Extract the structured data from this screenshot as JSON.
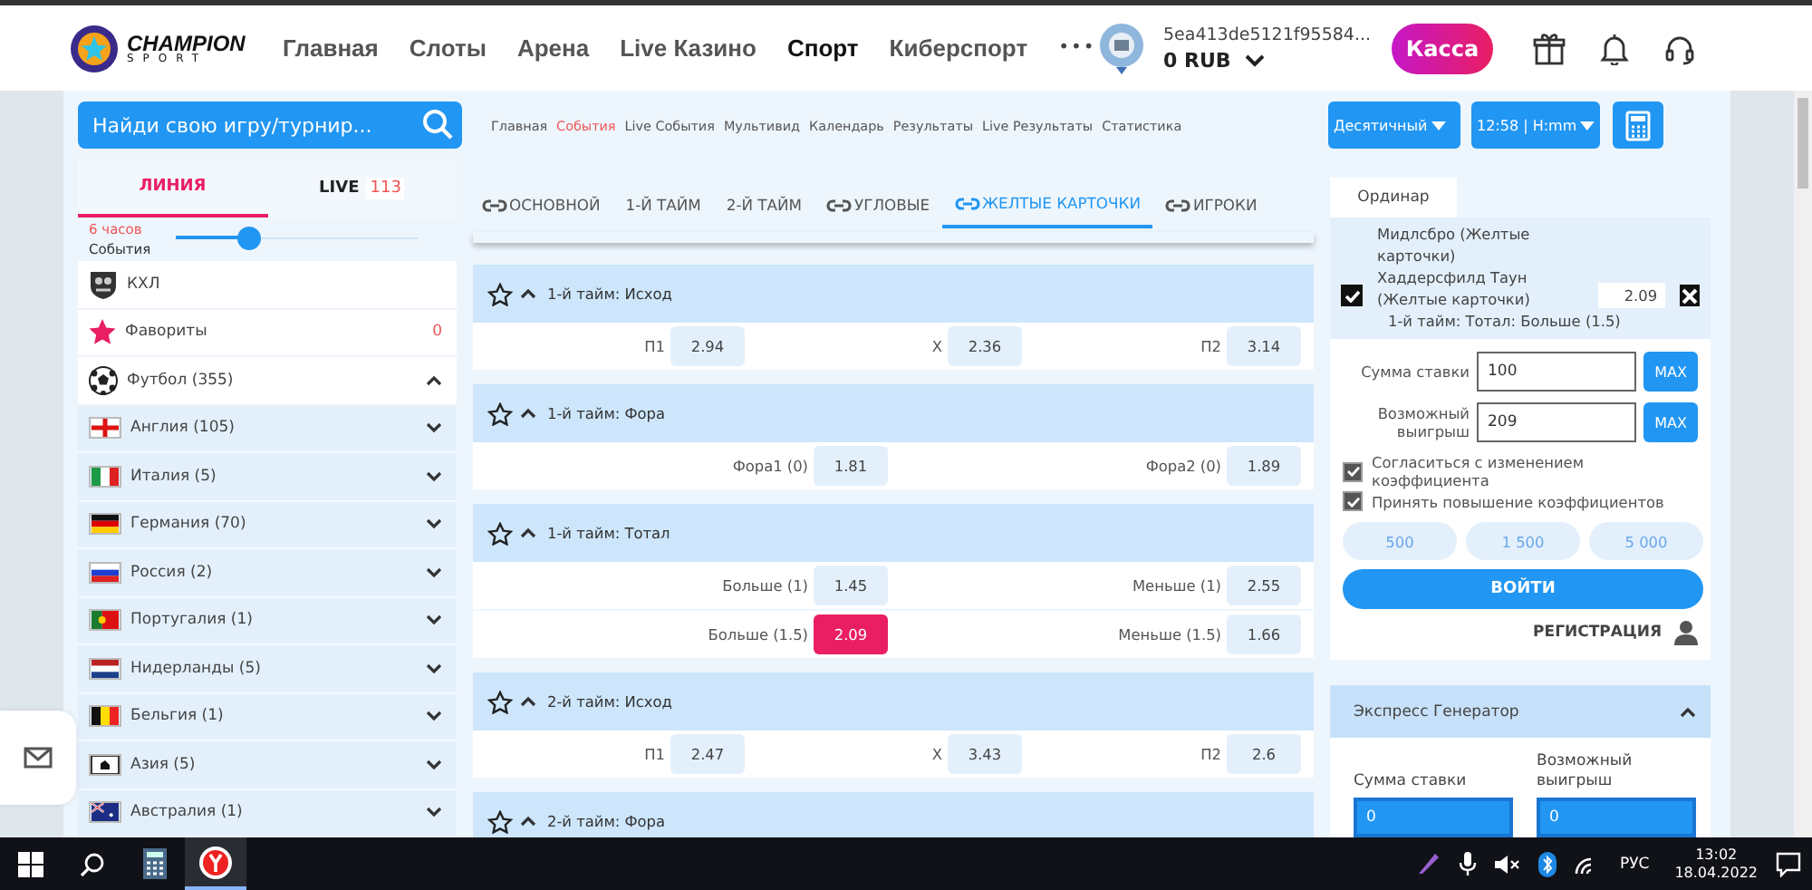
{
  "header": {
    "logo": {
      "title": "CHAMPION",
      "subtitle": "SPORT"
    },
    "nav": [
      {
        "label": "Главная",
        "selected": false
      },
      {
        "label": "Слоты",
        "selected": false
      },
      {
        "label": "Арена",
        "selected": false
      },
      {
        "label": "Live Казино",
        "selected": false
      },
      {
        "label": "Спорт",
        "selected": true
      },
      {
        "label": "Киберспорт",
        "selected": false
      }
    ],
    "more": "•••",
    "account": {
      "id": "5ea413de5121f95584...",
      "balance": "0 RUB"
    },
    "cashier": "Касса"
  },
  "toolbar": {
    "search": {
      "placeholder": "Найди свою игру/турнир..."
    },
    "links": [
      {
        "label": "Главная",
        "selected": false
      },
      {
        "label": "События",
        "selected": true
      },
      {
        "label": "Live События",
        "selected": false
      },
      {
        "label": "Мультивид",
        "selected": false
      },
      {
        "label": "Календарь",
        "selected": false
      },
      {
        "label": "Результаты",
        "selected": false
      },
      {
        "label": "Live Результаты",
        "selected": false
      },
      {
        "label": "Статистика",
        "selected": false
      }
    ],
    "odds_format": "Десятичный",
    "time_format": "12:58 | H:mm"
  },
  "sidebar": {
    "tabs": [
      {
        "label": "ЛИНИЯ",
        "selected": true
      },
      {
        "label": "LIVE",
        "count": "113",
        "selected": false
      }
    ],
    "filter": {
      "period": "6 часов",
      "label": "События",
      "level": 0.3
    },
    "items": [
      {
        "kind": "league",
        "label": "КХЛ"
      },
      {
        "kind": "favorites",
        "label": "Фавориты",
        "count": "0"
      },
      {
        "kind": "sport",
        "label": "Футбол (355)",
        "expanded": true,
        "children": [
          {
            "label": "Англия (105)",
            "expanded": false
          },
          {
            "label": "Италия (5)",
            "expanded": false
          },
          {
            "label": "Германия (70)",
            "expanded": false
          },
          {
            "label": "Россия (2)",
            "expanded": false
          },
          {
            "label": "Португалия (1)",
            "expanded": false
          },
          {
            "label": "Нидерланды (5)",
            "expanded": false
          },
          {
            "label": "Бельгия (1)",
            "expanded": false
          },
          {
            "label": "Азия (5)",
            "expanded": false
          },
          {
            "label": "Австралия (1)",
            "expanded": false
          }
        ]
      }
    ]
  },
  "market_tabs": [
    {
      "label": "ОСНОВНОЙ",
      "linked": true,
      "selected": false
    },
    {
      "label": "1-Й ТАЙМ",
      "linked": false,
      "selected": false
    },
    {
      "label": "2-Й ТАЙМ",
      "linked": false,
      "selected": false
    },
    {
      "label": "УГЛОВЫЕ",
      "linked": true,
      "selected": false
    },
    {
      "label": "ЖЕЛТЫЕ КАРТОЧКИ",
      "linked": true,
      "selected": true
    },
    {
      "label": "ИГРОКИ",
      "linked": true,
      "selected": false
    }
  ],
  "markets": [
    {
      "title": "1-й тайм: Исход",
      "rows": [
        [
          {
            "label": "П1",
            "odds": "2.94",
            "selected": false
          },
          {
            "label": "X",
            "odds": "2.36",
            "selected": false
          },
          {
            "label": "П2",
            "odds": "3.14",
            "selected": false
          }
        ]
      ]
    },
    {
      "title": "1-й тайм: Фора",
      "rows": [
        [
          {
            "label": "Фора1 (0)",
            "odds": "1.81",
            "selected": false
          },
          {
            "label": "Фора2 (0)",
            "odds": "1.89",
            "selected": false
          }
        ]
      ]
    },
    {
      "title": "1-й тайм: Тотал",
      "rows": [
        [
          {
            "label": "Больше (1)",
            "odds": "1.45",
            "selected": false
          },
          {
            "label": "Меньше (1)",
            "odds": "2.55",
            "selected": false
          }
        ],
        [
          {
            "label": "Больше (1.5)",
            "odds": "2.09",
            "selected": true
          },
          {
            "label": "Меньше (1.5)",
            "odds": "1.66",
            "selected": false
          }
        ]
      ]
    },
    {
      "title": "2-й тайм: Исход",
      "rows": [
        [
          {
            "label": "П1",
            "odds": "2.47",
            "selected": false
          },
          {
            "label": "X",
            "odds": "3.43",
            "selected": false
          },
          {
            "label": "П2",
            "odds": "2.6",
            "selected": false
          }
        ]
      ]
    },
    {
      "title": "2-й тайм: Фора"
    }
  ],
  "betslip": {
    "tabs": [
      {
        "label": "Ординар",
        "selected": true
      }
    ],
    "bet": {
      "teams": [
        "Мидлсбро (Желтые карточки)",
        "Хаддерсфилд Таун (Желтые карточки)"
      ],
      "checked": true,
      "odds": "2.09",
      "market": "1-й тайм: Тотал: Больше (1.5)"
    },
    "fields": [
      {
        "label": "Сумма ставки",
        "value": "100",
        "max": "MAX"
      },
      {
        "label": "Возможный выигрыш",
        "value": "209",
        "max": "MAX"
      }
    ],
    "options": [
      {
        "label": "Согласиться с изменением коэффициента",
        "checked": true
      },
      {
        "label": "Принять повышение коэффициентов",
        "checked": true
      }
    ],
    "quick_amounts": [
      "500",
      "1 500",
      "5 000"
    ],
    "login": "ВОЙТИ",
    "register": "РЕГИСТРАЦИЯ"
  },
  "express": {
    "title": "Экспресс Генератор",
    "expanded": true,
    "fields": [
      {
        "label": "Сумма ставки",
        "value": "0"
      },
      {
        "label": "Возможный выигрыш",
        "value": "0"
      }
    ]
  },
  "taskbar": {
    "language": "РУС",
    "time": "13:02",
    "date": "18.04.2022"
  }
}
